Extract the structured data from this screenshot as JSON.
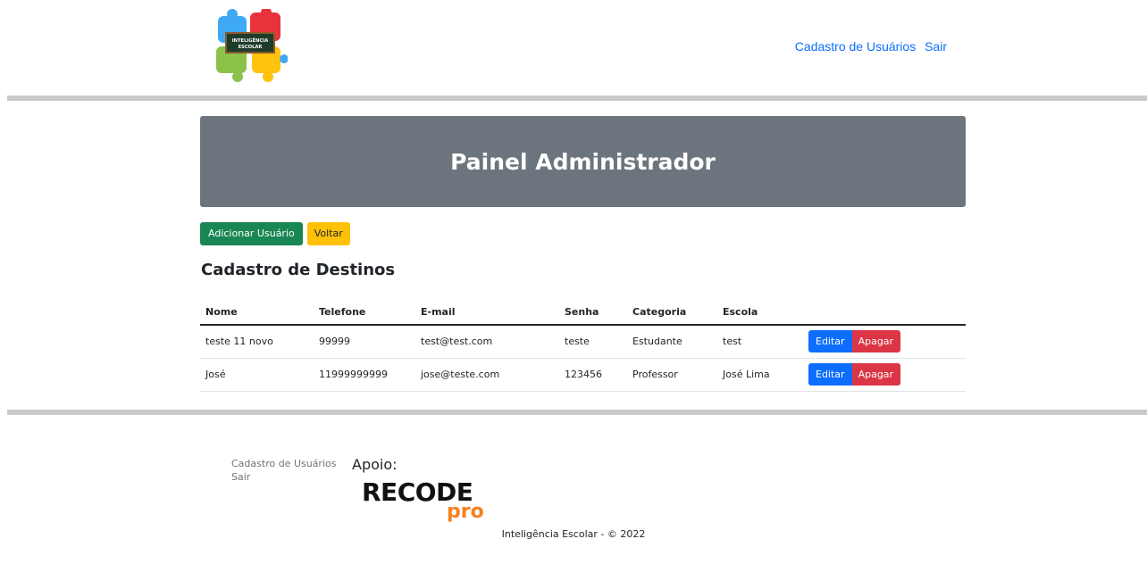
{
  "header": {
    "logo_text": "INTELIGÊNCIA ESCOLAR",
    "nav": [
      {
        "label": "Cadastro de Usuários"
      },
      {
        "label": "Sair"
      }
    ]
  },
  "panel": {
    "title": "Painel Administrador"
  },
  "actions": {
    "add_user_label": "Adicionar Usuário",
    "back_label": "Voltar"
  },
  "section_title": "Cadastro de Destinos",
  "table": {
    "headers": [
      "Nome",
      "Telefone",
      "E-mail",
      "Senha",
      "Categoria",
      "Escola",
      ""
    ],
    "rows": [
      {
        "nome": "teste 11 novo",
        "telefone": "99999",
        "email": "test@test.com",
        "senha": "teste",
        "categoria": "Estudante",
        "escola": "test"
      },
      {
        "nome": "José",
        "telefone": "11999999999",
        "email": "jose@teste.com",
        "senha": "123456",
        "categoria": "Professor",
        "escola": "José Lima"
      }
    ],
    "edit_label": "Editar",
    "delete_label": "Apagar"
  },
  "footer": {
    "links": [
      {
        "label": "Cadastro de Usuários"
      },
      {
        "label": "Sair"
      }
    ],
    "apoio_label": "Apoio:",
    "sponsor_main": "RECODE",
    "sponsor_sub": "pro",
    "copyright": "Inteligência Escolar - © 2022"
  },
  "colors": {
    "primary": "#0d6efd",
    "success": "#198754",
    "warning": "#ffc107",
    "danger": "#dc3545",
    "panel": "#6c757d",
    "separator": "#c9c9c9",
    "sponsor_accent": "#f58220"
  }
}
